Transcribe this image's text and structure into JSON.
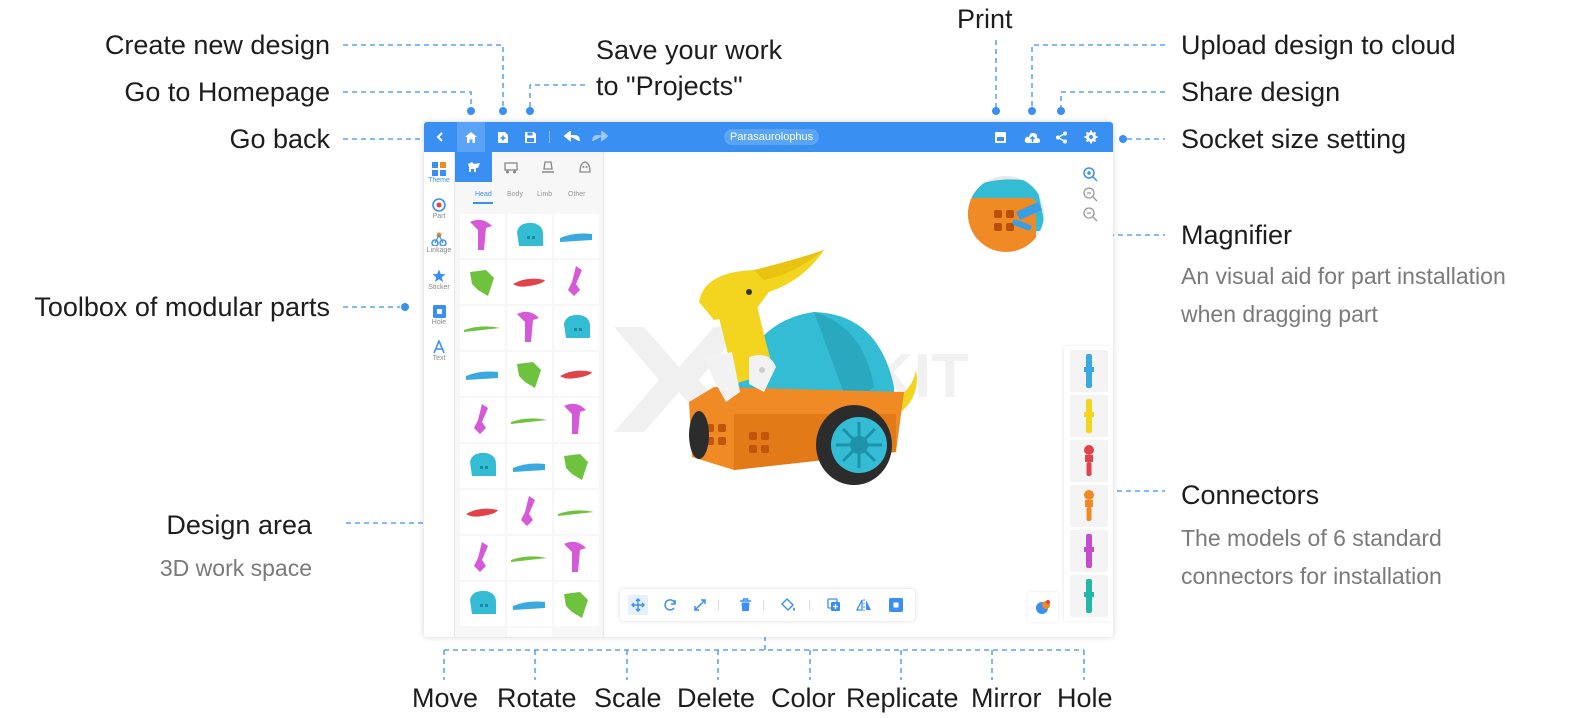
{
  "annotations": {
    "create_new_design": "Create new design",
    "go_to_homepage": "Go to Homepage",
    "go_back": "Go back",
    "save_line1": "Save your work",
    "save_line2": "to \"Projects\"",
    "print": "Print",
    "upload": "Upload design to cloud",
    "share": "Share design",
    "socket_size": "Socket size setting",
    "magnifier": "Magnifier",
    "magnifier_desc_line1": "An visual aid for part installation",
    "magnifier_desc_line2": "when dragging part",
    "toolbox": "Toolbox of modular parts",
    "design_area": "Design area",
    "design_area_desc": "3D work space",
    "connectors": "Connectors",
    "connectors_desc_line1": "The models of 6 standard",
    "connectors_desc_line2": "connectors for installation",
    "bottom_tools": [
      "Move",
      "Rotate",
      "Scale",
      "Delete",
      "Color",
      "Replicate",
      "Mirror",
      "Hole"
    ]
  },
  "app": {
    "title": "Parasaurolophus",
    "left_sidebar": [
      "Theme",
      "Part",
      "Linkage",
      "Sticker",
      "Hole",
      "Text"
    ],
    "part_subtabs": [
      "Head",
      "Body",
      "Limb",
      "Other"
    ],
    "active_subtab": "Head",
    "watermark": "KIT",
    "colors": {
      "accent": "#3a8ff2",
      "pink": "#d55ad8",
      "cyan": "#33bcd4",
      "green": "#6ec23d",
      "red": "#e0434a",
      "orange": "#f08a24",
      "yellow": "#f3d41e"
    },
    "part_grid": [
      [
        "pink-head",
        "cyan-head",
        "blue-flat"
      ],
      [
        "green-head",
        "red-crest",
        "pink-arm"
      ],
      [
        "green-blade",
        "pink-head",
        "cyan-head"
      ],
      [
        "blue-flat",
        "green-head",
        "red-crest"
      ],
      [
        "pink-arm",
        "green-blade",
        "pink-head"
      ],
      [
        "cyan-head",
        "blue-flat",
        "green-head"
      ],
      [
        "red-crest",
        "pink-arm",
        "green-blade"
      ],
      [
        "pink-arm",
        "green-blade",
        "pink-head"
      ],
      [
        "cyan-head",
        "blue-flat",
        "green-head"
      ]
    ],
    "connectors": [
      "blue",
      "yellow",
      "red",
      "orange",
      "purple",
      "teal"
    ]
  }
}
